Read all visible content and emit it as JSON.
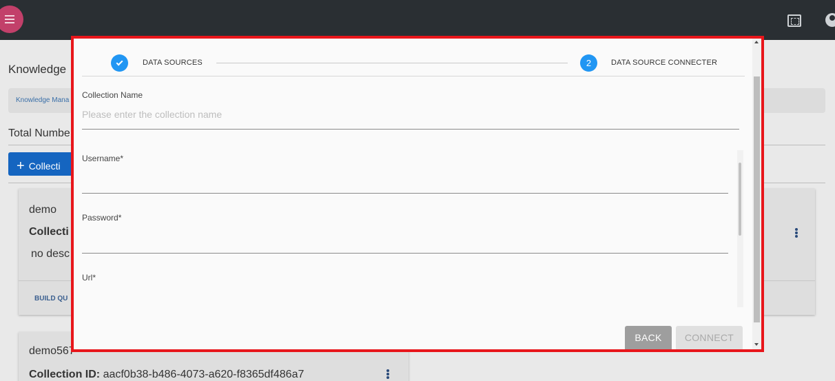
{
  "background": {
    "page_title": "Knowledge",
    "breadcrumb": "Knowledge Mana",
    "total_label": "Total Numbe",
    "add_button_label": "Collecti",
    "cards": [
      {
        "name": "demo",
        "id_label": "Collecti",
        "description": "no desc",
        "build_label": "BUILD QU"
      },
      {
        "name": "demo567",
        "id_label": "Collection ID:",
        "id_value": "aacf0b38-b486-4073-a620-f8365df486a7"
      }
    ]
  },
  "stepper": {
    "steps": [
      {
        "label": "DATA SOURCES",
        "state": "completed"
      },
      {
        "number": "2",
        "label": "DATA SOURCE CONNECTER",
        "state": "active"
      }
    ]
  },
  "form": {
    "collection_name": {
      "label": "Collection Name",
      "placeholder": "Please enter the collection name",
      "value": ""
    },
    "username": {
      "label": "Username*",
      "value": ""
    },
    "password": {
      "label": "Password*",
      "value": ""
    },
    "url": {
      "label": "Url*",
      "value": ""
    }
  },
  "actions": {
    "back_label": "BACK",
    "connect_label": "CONNECT"
  },
  "colors": {
    "step_accent": "#2196f3",
    "highlight_border": "#e8161b",
    "menu_button": "#c2406a"
  },
  "icons": {
    "menu": "menu-icon",
    "fullscreen": "fullscreen-icon",
    "account": "account-icon",
    "step_done": "check-icon",
    "more": "more-vert-icon"
  }
}
